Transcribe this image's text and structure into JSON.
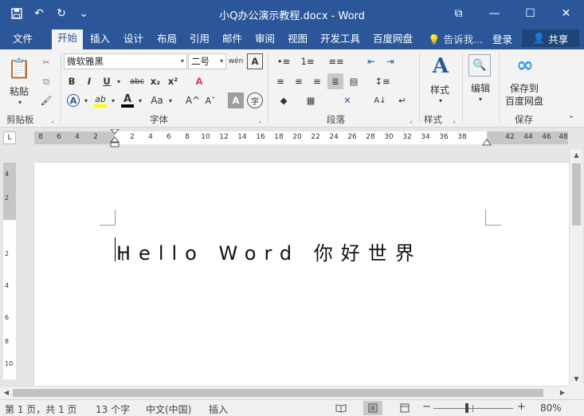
{
  "titlebar": {
    "title": "小Q办公演示教程.docx - Word",
    "qat": [
      {
        "icon": "save-icon",
        "glyph": "💾"
      },
      {
        "icon": "undo-icon",
        "glyph": "↶"
      },
      {
        "icon": "redo-icon",
        "glyph": "↻"
      },
      {
        "icon": "customize-qat-icon",
        "glyph": "⌄"
      }
    ],
    "controls": [
      {
        "icon": "ribbon-display-icon",
        "glyph": "⧉"
      },
      {
        "icon": "minimize-icon",
        "glyph": "—"
      },
      {
        "icon": "maximize-icon",
        "glyph": "☐"
      },
      {
        "icon": "close-icon",
        "glyph": "✕"
      }
    ]
  },
  "tabs": [
    {
      "label": "文件",
      "active": false
    },
    {
      "label": "开始",
      "active": true
    },
    {
      "label": "插入",
      "active": false
    },
    {
      "label": "设计",
      "active": false
    },
    {
      "label": "布局",
      "active": false
    },
    {
      "label": "引用",
      "active": false
    },
    {
      "label": "邮件",
      "active": false
    },
    {
      "label": "审阅",
      "active": false
    },
    {
      "label": "视图",
      "active": false
    },
    {
      "label": "开发工具",
      "active": false
    },
    {
      "label": "百度网盘",
      "active": false
    }
  ],
  "tellme": {
    "glyph": "💡",
    "text": "告诉我..."
  },
  "login_label": "登录",
  "share_label": "共享",
  "ribbon": {
    "clipboard": {
      "label": "剪贴板",
      "paste_label": "粘贴",
      "paste_glyph": "📋",
      "cut_glyph": "✂",
      "copy_glyph": "⧉",
      "format_painter_glyph": "🖌"
    },
    "font": {
      "label": "字体",
      "font_name": "微软雅黑",
      "font_size": "二号",
      "wen_glyph": "wén",
      "a_box_glyph": "A",
      "bold": "B",
      "italic": "I",
      "underline": "U",
      "strikethrough": "abc",
      "subscript": "x₂",
      "superscript": "x²",
      "clear_format_glyph": "A",
      "text_effects": "A",
      "highlight": "ab",
      "font_color": "A",
      "change_case": "Aa",
      "grow_font": "A^",
      "shrink_font": "Aˇ",
      "char_shading": "A",
      "enclose_char": "字",
      "highlight_color": "#ffff00",
      "font_color_value": "#000000",
      "text_effect_color": "#2b579a"
    },
    "paragraph": {
      "label": "段落",
      "row1": [
        "•≡",
        "1≡",
        "≡≡",
        "⇤",
        "⇥",
        "中",
        "⇅"
      ],
      "row2": [
        "≡",
        "≡",
        "≡",
        "≣",
        "▤",
        "↕≡"
      ],
      "row3": [
        "◆",
        "▦",
        "✕",
        "A↓",
        "↵"
      ]
    },
    "styles": {
      "label": "样式",
      "button_label": "样式",
      "glyph": "A"
    },
    "editing": {
      "button_label": "编辑",
      "glyph": "🔍"
    },
    "save": {
      "label": "保存",
      "button_label_1": "保存到",
      "button_label_2": "百度网盘",
      "glyph": "∞"
    }
  },
  "ruler": {
    "corner_glyph": "L",
    "ticks_left": [
      "8",
      "6",
      "4",
      "2"
    ],
    "ticks_right": [
      "2",
      "4",
      "6",
      "8",
      "10",
      "12",
      "14",
      "16",
      "18",
      "20",
      "22",
      "24",
      "26",
      "28",
      "30",
      "32",
      "34",
      "36",
      "38",
      "42",
      "44",
      "46",
      "48"
    ],
    "vticks": [
      "4",
      "2",
      "2",
      "4",
      "6",
      "8",
      "10"
    ]
  },
  "document": {
    "text": "Hello Word 你好世界",
    "ibeam": "I"
  },
  "statusbar": {
    "page_info": "第 1 页，共 1 页",
    "word_count": "13 个字",
    "language": "中文(中国)",
    "insert_mode": "插入",
    "zoom_out": "−",
    "zoom_in": "+",
    "zoom_level": "80%",
    "views": [
      {
        "icon": "read-mode-icon",
        "glyph": "📖"
      },
      {
        "icon": "print-layout-icon",
        "glyph": "▤"
      },
      {
        "icon": "web-layout-icon",
        "glyph": "⊟"
      }
    ]
  }
}
